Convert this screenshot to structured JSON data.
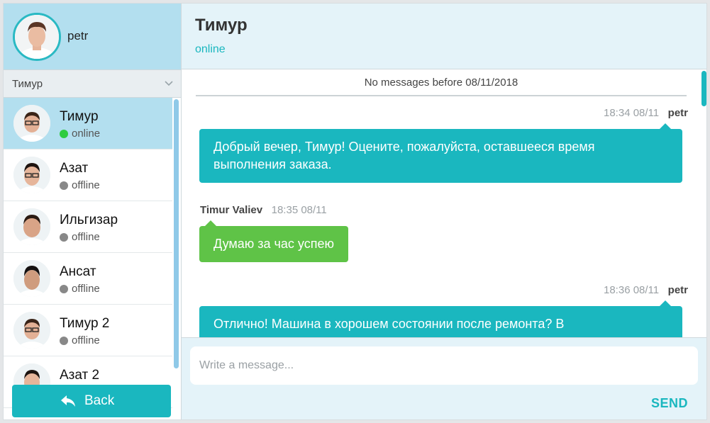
{
  "user": {
    "name": "petr"
  },
  "filter": {
    "value": "Тимур"
  },
  "contacts": [
    {
      "name": "Тимур",
      "status": "online"
    },
    {
      "name": "Азат",
      "status": "offline"
    },
    {
      "name": "Ильгизар",
      "status": "offline"
    },
    {
      "name": "Ансат",
      "status": "offline"
    },
    {
      "name": "Тимур 2",
      "status": "offline"
    },
    {
      "name": "Азат 2",
      "status": ""
    }
  ],
  "back_label": "Back",
  "chat": {
    "title": "Тимур",
    "status": "online",
    "no_more": "No messages before 08/11/2018",
    "messages": [
      {
        "time": "18:34 08/11",
        "author": "petr",
        "text": "Добрый вечер, Тимур! Оцените, пожалуйста, оставшееся время выполнения заказа."
      },
      {
        "author": "Timur Valiev",
        "time": "18:35 08/11",
        "text": "Думаю за час успею"
      },
      {
        "time": "18:36 08/11",
        "author": "petr",
        "text": "Отлично! Машина в хорошем состоянии после ремонта? В"
      }
    ]
  },
  "composer": {
    "placeholder": "Write a message...",
    "send_label": "SEND"
  },
  "colors": {
    "accent": "#1ab7bf",
    "incoming": "#5fc347",
    "panel": "#b3dfef",
    "header_bg": "#e4f3f9",
    "online": "#2ecc40",
    "offline": "#888888"
  }
}
